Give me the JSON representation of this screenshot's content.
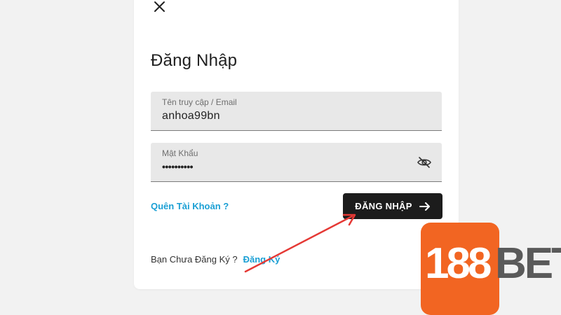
{
  "dialog": {
    "title": "Đăng Nhập"
  },
  "username_field": {
    "label": "Tên truy cập / Email",
    "value": "anhoa99bn"
  },
  "password_field": {
    "label": "Mật Khẩu",
    "value": "••••••••••"
  },
  "forgot_link": "Quên Tài Khoản ?",
  "login_button": "ĐĂNG NHẬP",
  "signup": {
    "prompt": "Bạn Chưa Đăng Ký ?",
    "link": "Đăng Ký"
  },
  "brand": {
    "number": "188",
    "text": "BET"
  },
  "colors": {
    "accent_link": "#1a9fd4",
    "button_bg": "#1c1c1c",
    "brand_orange": "#f26522",
    "annotation_red": "#e53935"
  },
  "icons": {
    "close": "close-icon",
    "eye": "eye-off-icon",
    "arrow": "arrow-right-icon"
  }
}
